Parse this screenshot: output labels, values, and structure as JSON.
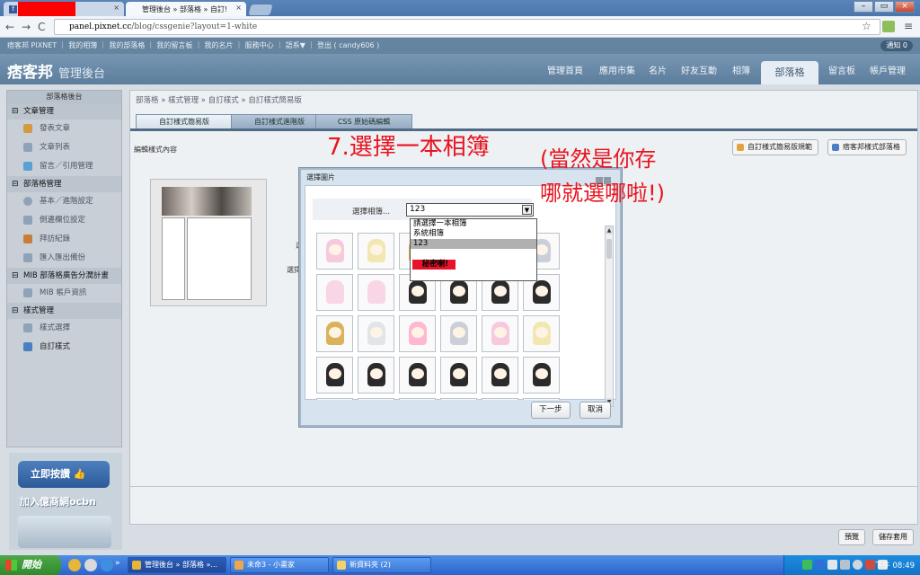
{
  "browser": {
    "tabs": [
      {
        "label": "",
        "close": "×"
      },
      {
        "label": "管理後台 » 部落格 » 自訂!",
        "close": "×"
      }
    ],
    "window_buttons": [
      "–",
      "▭",
      "×"
    ],
    "url_host": "panel.pixnet.cc",
    "url_path": "/blog/cssgenie?layout=1-white",
    "nav": {
      "back": "←",
      "forward": "→",
      "reload": "C",
      "star": "☆",
      "menu": "≡"
    }
  },
  "pix_topbar": {
    "links": [
      "痞客邦 PIXNET",
      "我的相簿",
      "我的部落格",
      "我的留言板",
      "我的名片",
      "服務中心",
      "語系▼",
      "登出 ( candy606 )"
    ],
    "notify": "通知 0"
  },
  "pix_header": {
    "logo": "痞客邦",
    "logo_sub": "管理後台",
    "nav": [
      "管理首頁",
      "應用市集",
      "名片",
      "好友互動",
      "相簿",
      "部落格",
      "留言板",
      "帳戶管理"
    ],
    "active": "部落格"
  },
  "sidebar": {
    "title": "部落格後台",
    "sections": [
      {
        "label": "文章管理",
        "items": [
          "發表文章",
          "文章列表",
          "留言／引用管理"
        ]
      },
      {
        "label": "部落格管理",
        "items": [
          "基本／進階設定",
          "側邊欄位設定",
          "拜訪紀錄",
          "匯入匯出備份"
        ]
      },
      {
        "label": "MIB 部落格廣告分潤計畫",
        "items": [
          "MIB 帳戶資訊"
        ]
      },
      {
        "label": "樣式管理",
        "items": [
          "樣式選擇",
          "自訂樣式"
        ]
      }
    ]
  },
  "promo": {
    "button": "立即按讚",
    "text": "加入億商網ocbn"
  },
  "main": {
    "breadcrumb": "部落格 » 樣式管理 » 自訂樣式 » 自訂樣式簡易版",
    "subtabs": [
      "自訂樣式簡易版",
      "自訂樣式進階版",
      "CSS 原始碼編輯"
    ],
    "edit_label": "編輯樣式內容",
    "right_buttons": [
      "自訂樣式簡易版規範",
      "痞客邦樣式部落格"
    ],
    "stub_labels": [
      "選",
      "選擇"
    ],
    "bottom_buttons": [
      "預覽",
      "儲存套用"
    ]
  },
  "dialog": {
    "title": "選擇圖片",
    "album_label": "選擇相簿...",
    "album_value": "123",
    "dropdown_options": [
      "請選擇一本相簿",
      "系統相簿",
      "123"
    ],
    "dropdown_selected": "123",
    "secret_badge": "秘密喇!",
    "buttons": {
      "next": "下一步",
      "cancel": "取消"
    }
  },
  "annotations": {
    "step": "7.選擇一本相簿",
    "note_line1": "(當然是你存",
    "note_line2": "哪就選哪啦!)"
  },
  "taskbar": {
    "start": "開始",
    "tasks": [
      "管理後台 » 部落格 »...",
      "未命3 - 小畫家",
      "新資料夾 (2)"
    ],
    "overflow": "»",
    "clock": "下午 08:49"
  },
  "colors": {
    "annotation": "#e8131e",
    "secret_badge": "#e8122a",
    "header": "#6b8cab"
  }
}
